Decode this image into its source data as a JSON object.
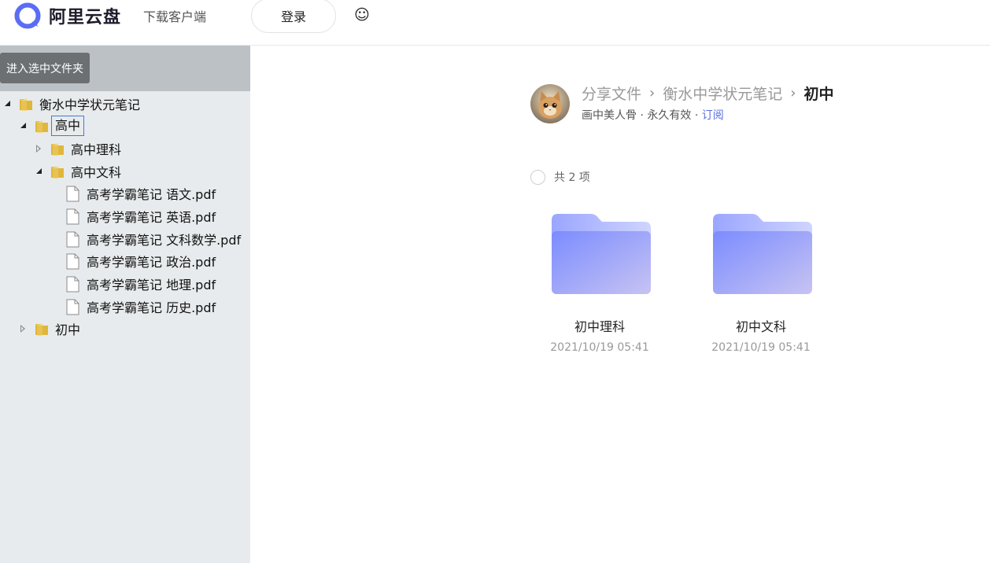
{
  "header": {
    "brand": "阿里云盘",
    "download_label": "下载客户端",
    "login_label": "登录",
    "emoji": "☺"
  },
  "sidebar": {
    "enter_button": "进入选中文件夹",
    "tree": [
      {
        "label": "衡水中学状元笔记",
        "type": "folder",
        "expanded": true
      },
      {
        "label": "高中",
        "type": "folder",
        "expanded": true,
        "selected": true
      },
      {
        "label": "高中理科",
        "type": "folder",
        "expanded": false
      },
      {
        "label": "高中文科",
        "type": "folder",
        "expanded": true
      },
      {
        "label": "高考学霸笔记 语文.pdf",
        "type": "file"
      },
      {
        "label": "高考学霸笔记 英语.pdf",
        "type": "file"
      },
      {
        "label": "高考学霸笔记 文科数学.pdf",
        "type": "file"
      },
      {
        "label": "高考学霸笔记 政治.pdf",
        "type": "file"
      },
      {
        "label": "高考学霸笔记 地理.pdf",
        "type": "file"
      },
      {
        "label": "高考学霸笔记 历史.pdf",
        "type": "file"
      },
      {
        "label": "初中",
        "type": "folder",
        "expanded": false
      }
    ]
  },
  "main": {
    "breadcrumb": [
      "分享文件",
      "衡水中学状元笔记",
      "初中"
    ],
    "owner": "画中美人骨",
    "validity": "永久有效",
    "subscribe": "订阅",
    "count_label": "共 2 项",
    "items": [
      {
        "name": "初中理科",
        "date": "2021/10/19 05:41"
      },
      {
        "name": "初中文科",
        "date": "2021/10/19 05:41"
      }
    ]
  },
  "colors": {
    "accent": "#5a6fe0",
    "sidebar_bg": "#e8ebed",
    "folder_blue": "#8a9cff"
  }
}
